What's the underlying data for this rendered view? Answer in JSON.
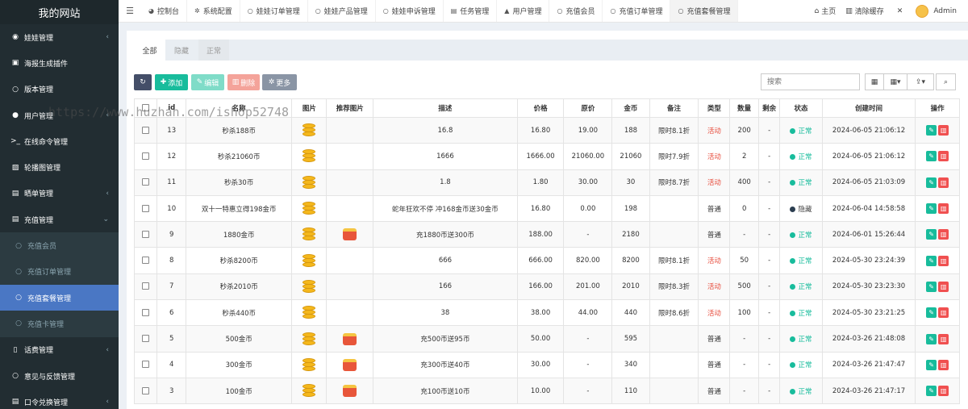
{
  "sidebar": {
    "logo": "我的网站",
    "items": [
      {
        "label": "娃娃管理",
        "icon": "doll-icon",
        "arrow": "‹",
        "type": "white"
      },
      {
        "label": "海报生成插件",
        "icon": "image-icon",
        "arrow": "",
        "type": "white"
      },
      {
        "label": "版本管理",
        "icon": "circle-icon",
        "arrow": "",
        "type": "white"
      },
      {
        "label": "用户管理",
        "icon": "user-icon",
        "arrow": "‹",
        "type": "white"
      },
      {
        "label": "在线命令管理",
        "icon": "terminal-icon",
        "arrow": "",
        "type": "white"
      },
      {
        "label": "轮播图管理",
        "icon": "picture-icon",
        "arrow": "",
        "type": "white"
      },
      {
        "label": "晒单管理",
        "icon": "list-icon",
        "arrow": "‹",
        "type": "white"
      },
      {
        "label": "充值管理",
        "icon": "list-icon",
        "arrow": "⌄",
        "type": "white"
      },
      {
        "label": "充值会员",
        "icon": "circle-icon",
        "arrow": "",
        "type": "sub"
      },
      {
        "label": "充值订单管理",
        "icon": "circle-icon",
        "arrow": "",
        "type": "sub"
      },
      {
        "label": "充值套餐管理",
        "icon": "circle-icon",
        "arrow": "",
        "type": "active"
      },
      {
        "label": "充值卡管理",
        "icon": "circle-icon",
        "arrow": "",
        "type": "sub"
      },
      {
        "label": "话费管理",
        "icon": "phone-icon",
        "arrow": "‹",
        "type": "white"
      },
      {
        "label": "意见与反馈管理",
        "icon": "circle-icon",
        "arrow": "",
        "type": "white"
      },
      {
        "label": "口令兑换管理",
        "icon": "list-icon",
        "arrow": "‹",
        "type": "white"
      }
    ]
  },
  "topbar": {
    "tabs": [
      {
        "label": "控制台",
        "icon": "dashboard-icon",
        "glyph": "◕"
      },
      {
        "label": "系统配置",
        "icon": "cog-icon",
        "glyph": "✲"
      },
      {
        "label": "娃娃订单管理",
        "icon": "circle-icon",
        "glyph": "○"
      },
      {
        "label": "娃娃产品管理",
        "icon": "circle-icon",
        "glyph": "○"
      },
      {
        "label": "娃娃申诉管理",
        "icon": "circle-icon",
        "glyph": "○"
      },
      {
        "label": "任务管理",
        "icon": "task-icon",
        "glyph": "▤"
      },
      {
        "label": "用户管理",
        "icon": "user-icon",
        "glyph": "▲"
      },
      {
        "label": "充值会员",
        "icon": "circle-icon",
        "glyph": "○"
      },
      {
        "label": "充值订单管理",
        "icon": "circle-icon",
        "glyph": "○"
      },
      {
        "label": "充值套餐管理",
        "icon": "circle-icon",
        "glyph": "○"
      }
    ],
    "home": "主页",
    "clear_cache": "清除缓存",
    "user": "Admin"
  },
  "filter_tabs": [
    "全部",
    "隐藏",
    "正常"
  ],
  "toolbar": {
    "add": "添加",
    "edit": "编辑",
    "delete": "删除",
    "more": "更多"
  },
  "search": {
    "placeholder": "搜索"
  },
  "table": {
    "headers": [
      "",
      "id",
      "名称",
      "图片",
      "推荐图片",
      "描述",
      "价格",
      "原价",
      "金币",
      "备注",
      "类型",
      "数量",
      "剩余",
      "状态",
      "创建时间",
      "操作"
    ],
    "rows": [
      {
        "id": "13",
        "name": "秒杀188币",
        "rec": false,
        "desc": "16.8",
        "price": "16.80",
        "orig": "19.00",
        "coin": "188",
        "note": "限时8.1折",
        "type": "活动",
        "hot": true,
        "qty": "200",
        "left": "-",
        "status": "正常",
        "on": true,
        "time": "2024-06-05 21:06:12"
      },
      {
        "id": "12",
        "name": "秒杀21060币",
        "rec": false,
        "desc": "1666",
        "price": "1666.00",
        "orig": "21060.00",
        "coin": "21060",
        "note": "限时7.9折",
        "type": "活动",
        "hot": true,
        "qty": "2",
        "left": "-",
        "status": "正常",
        "on": true,
        "time": "2024-06-05 21:06:12"
      },
      {
        "id": "11",
        "name": "秒杀30币",
        "rec": false,
        "desc": "1.8",
        "price": "1.80",
        "orig": "30.00",
        "coin": "30",
        "note": "限时8.7折",
        "type": "活动",
        "hot": true,
        "qty": "400",
        "left": "-",
        "status": "正常",
        "on": true,
        "time": "2024-06-05 21:03:09"
      },
      {
        "id": "10",
        "name": "双十一特惠立得198金币",
        "rec": false,
        "desc": "蛇年狂欢不停 冲168金币送30金币",
        "price": "16.80",
        "orig": "0.00",
        "coin": "198",
        "note": "",
        "type": "普通",
        "hot": false,
        "qty": "0",
        "left": "-",
        "status": "隐藏",
        "on": false,
        "time": "2024-06-04 14:58:58"
      },
      {
        "id": "9",
        "name": "1880金币",
        "rec": true,
        "desc": "充1880币送300币",
        "price": "188.00",
        "orig": "-",
        "coin": "2180",
        "note": "",
        "type": "普通",
        "hot": false,
        "qty": "-",
        "left": "-",
        "status": "正常",
        "on": true,
        "time": "2024-06-01 15:26:44"
      },
      {
        "id": "8",
        "name": "秒杀8200币",
        "rec": false,
        "desc": "666",
        "price": "666.00",
        "orig": "820.00",
        "coin": "8200",
        "note": "限时8.1折",
        "type": "活动",
        "hot": true,
        "qty": "50",
        "left": "-",
        "status": "正常",
        "on": true,
        "time": "2024-05-30 23:24:39"
      },
      {
        "id": "7",
        "name": "秒杀2010币",
        "rec": false,
        "desc": "166",
        "price": "166.00",
        "orig": "201.00",
        "coin": "2010",
        "note": "限时8.3折",
        "type": "活动",
        "hot": true,
        "qty": "500",
        "left": "-",
        "status": "正常",
        "on": true,
        "time": "2024-05-30 23:23:30"
      },
      {
        "id": "6",
        "name": "秒杀440币",
        "rec": false,
        "desc": "38",
        "price": "38.00",
        "orig": "44.00",
        "coin": "440",
        "note": "限时8.6折",
        "type": "活动",
        "hot": true,
        "qty": "100",
        "left": "-",
        "status": "正常",
        "on": true,
        "time": "2024-05-30 23:21:25"
      },
      {
        "id": "5",
        "name": "500金币",
        "rec": true,
        "desc": "充500币送95币",
        "price": "50.00",
        "orig": "-",
        "coin": "595",
        "note": "",
        "type": "普通",
        "hot": false,
        "qty": "-",
        "left": "-",
        "status": "正常",
        "on": true,
        "time": "2024-03-26 21:48:08"
      },
      {
        "id": "4",
        "name": "300金币",
        "rec": true,
        "desc": "充300币送40币",
        "price": "30.00",
        "orig": "-",
        "coin": "340",
        "note": "",
        "type": "普通",
        "hot": false,
        "qty": "-",
        "left": "-",
        "status": "正常",
        "on": true,
        "time": "2024-03-26 21:47:47"
      },
      {
        "id": "3",
        "name": "100金币",
        "rec": true,
        "desc": "充100币送10币",
        "price": "10.00",
        "orig": "-",
        "coin": "110",
        "note": "",
        "type": "普通",
        "hot": false,
        "qty": "-",
        "left": "-",
        "status": "正常",
        "on": true,
        "time": "2024-03-26 21:47:17"
      }
    ]
  },
  "watermark": "https://www.huzhan.com/ishop52748",
  "colors": {
    "sidebar": "#222d32",
    "active": "#4a77c4",
    "success": "#18bc9c",
    "danger": "#f05050",
    "hot": "#e74c3c"
  }
}
